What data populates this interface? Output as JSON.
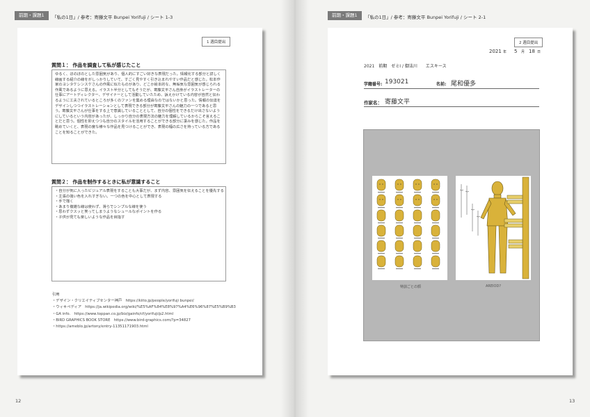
{
  "left_page": {
    "tag": "前期・課題1",
    "header_title": "「私の1日」/ 参考：寄藤文平 Bunpei Yorifuji / シート 1-3",
    "badge": "1 週目提出",
    "q1_title": "質問１： 作品を調査して私が感じたこと",
    "q1_answer": "ゆるく、ほのぼのとした雰囲気があり、個人的にすごい好きな表現だった。情報化する部分と詳しく線画する紹介の線をがしっかりしていて、すごく見やすく引き込まれやすい作品だと感じた。松本作家のヨシタケシンスケさんの作風に似たものがあり、どこか絵本的な、無垢気な雰囲気が感じられる作風であるように思える。イラスト半分としてもそうだが、寄藤文平さん自身がイラストレーターの仕事にアートディレクター、デザイナーとして活動していたため、訴えかけている内容が自然と伝わるように工夫されているところが多くのファンを集める理由なのではないかと思った。情報の伝達をデザインしつつイラストレーションとして表現できる部分が寄藤文平さんの魅力の一つであると思う。寄藤文平さんが仕事をする上で意識していることとして、自分の個性をできるだけ出さないようにしているという内容があったが、しっかり自分の表現方法の魅力を理解しているからこそ言えることだと思う。個性を抑えつつも自分のスタイルを活用することができる部分に凄みを感じた。作品を眺めていくと、表現の度な様々な作品を見つけることができ、表現の幅の広さを持っている方であることを知ることができた。",
    "q2_title": "質問２： 作品を制作するときに私が意識すること",
    "q2_items": [
      "・自分が気に入ったビジュアル表現をすることも大事だが、まず内容、雰囲気を伝えることを優先する",
      "・主張の強い色を入れすぎない。一つの色を中心として表現する",
      "・手で描く",
      "・あまり複雑な線は使わず、滑らでシンプルな線を使う",
      "・思わずクスッと笑ってしまうようなシュールなポイントを作る",
      "・子供が見ても楽しいような作品を目指す"
    ],
    "refs_title": "引用",
    "refs": [
      "・デザイン・クリエイティブセンター神戸　https://kiito.jp/people/yorifuji bunpei/",
      "・ウィキペディア　https://ja.wikipedia.org/wiki/%E5%AF%84%E8%97%A4%E6%96%87%E5%B9%B3",
      "・GA info.　https://www.toppan.co.jp/biz/gainfo/cf/yorifuji/p2.html",
      "・BIRD GRAPHICS BOOK STORE　https://www.bird-graphics.com/?p=34827",
      "・https://ameblo.jp/artony/entry-11351171903.html"
    ],
    "page_number": "12"
  },
  "right_page": {
    "tag": "前期・課題1",
    "header_title": "「私の1日」/ 参考：寄藤文平 Bunpei Yorifuji / シート 2-1",
    "badge": "2 週目提出",
    "date_year": "2021",
    "date_year_unit": "年",
    "date_month": "5",
    "date_month_unit": "月",
    "date_day": "18",
    "date_day_unit": "日",
    "course_line": "2021　前期　ゼミI / 御法川　　エスキース",
    "student_id_label": "学籍番号:",
    "student_id": "193021",
    "name_label": "名前:",
    "name": "尾和優多",
    "author_label": "作家名：",
    "author": "寄藤文平",
    "caption_left": "特訓ごとの顔",
    "caption_right": "AREIOD?",
    "page_number": "13"
  },
  "colors": {
    "sketch_yellow": "#d9b23a",
    "panel_gray": "#b7b7b7",
    "tag_gray": "#7a7a7a"
  }
}
